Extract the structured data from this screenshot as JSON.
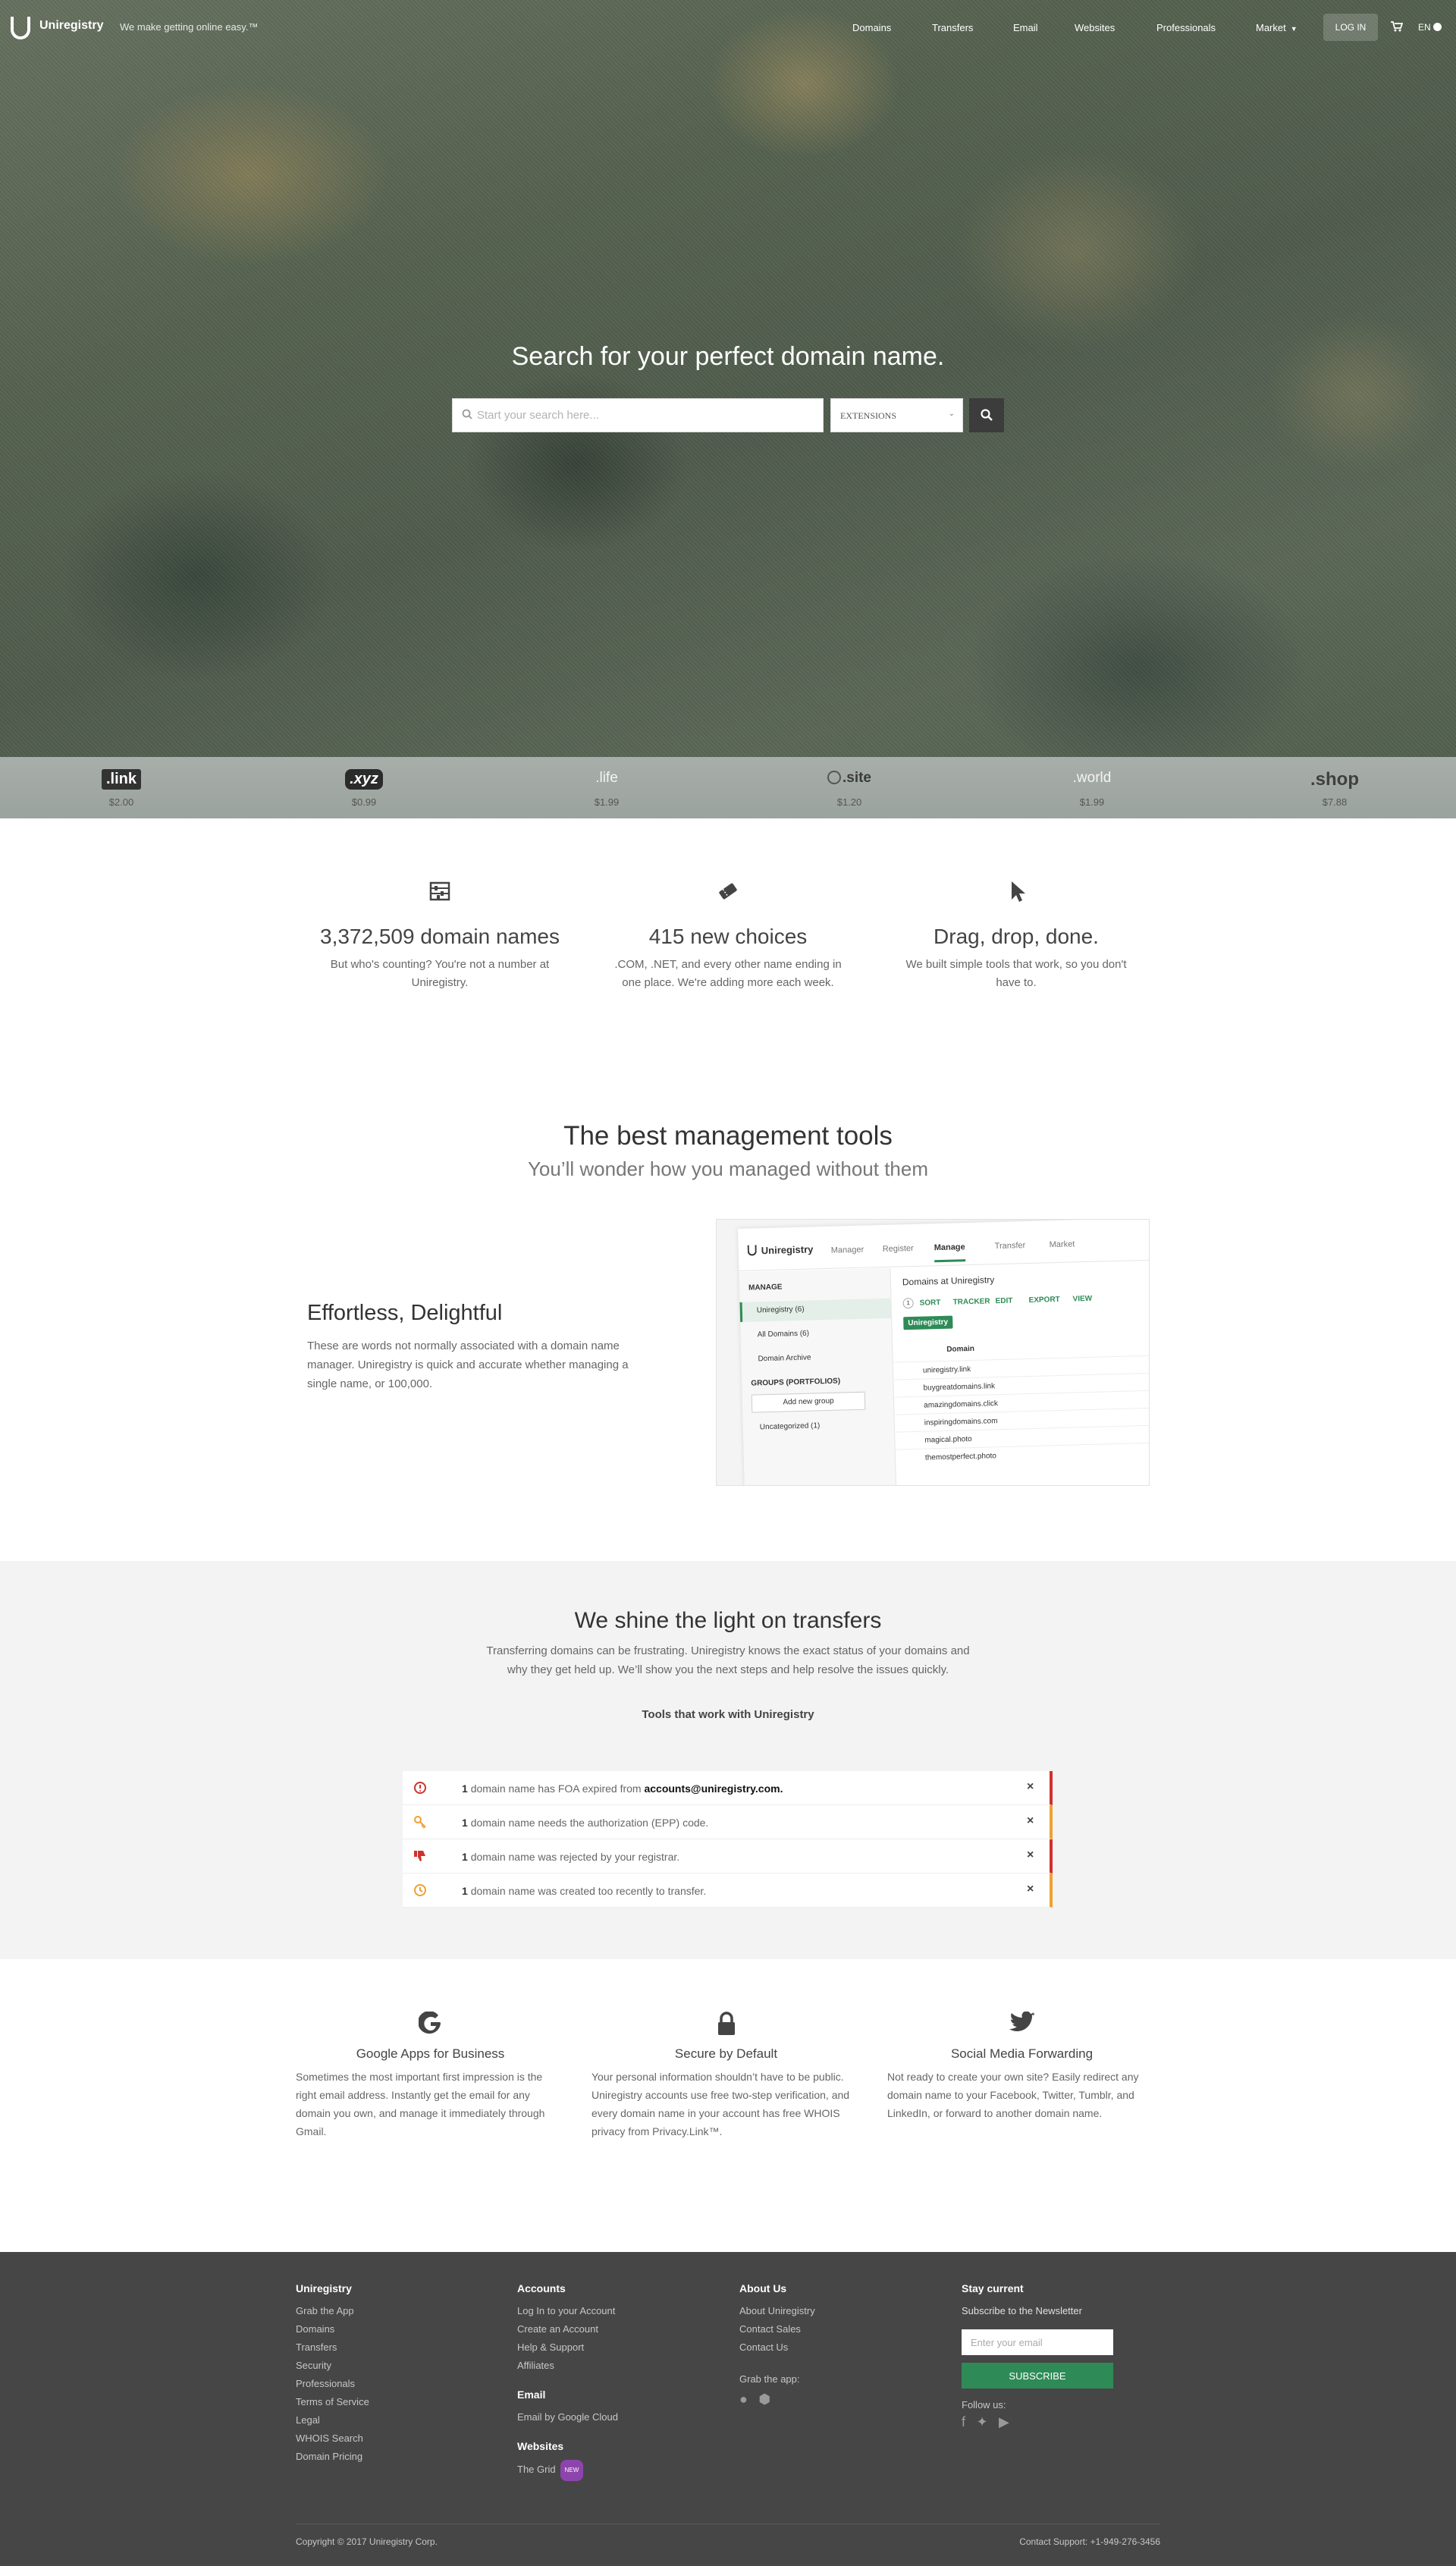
{
  "nav": {
    "brand": "Uniregistry",
    "tagline": "We make getting online easy.™",
    "links": [
      "Domains",
      "Transfers",
      "Email",
      "Websites",
      "Professionals",
      "Market"
    ],
    "login": "LOG IN",
    "lang": "EN"
  },
  "hero": {
    "title": "Search for your perfect domain name.",
    "search_placeholder": "Start your search here...",
    "extensions_label": "EXTENSIONS"
  },
  "tlds": [
    {
      "name": ".link",
      "price": "$2.00"
    },
    {
      "name": ".xyz",
      "price": "$0.99"
    },
    {
      "name": ".life",
      "price": "$1.99"
    },
    {
      "name": ".site",
      "price": "$1.20"
    },
    {
      "name": ".world",
      "price": "$1.99"
    },
    {
      "name": ".shop",
      "price": "$7.88"
    }
  ],
  "stats": [
    {
      "icon": "abacus-icon",
      "title": "3,372,509 domain names",
      "text": "But who's counting? You're not a number at Uniregistry."
    },
    {
      "icon": "ticket-icon",
      "title": "415 new choices",
      "text": ".COM, .NET, and every other name ending in one place. We're adding more each week."
    },
    {
      "icon": "cursor-icon",
      "title": "Drag, drop, done.",
      "text": "We built simple tools that work, so you don't have to."
    }
  ],
  "tools": {
    "title": "The best management tools",
    "subtitle": "You’ll wonder how you managed without them",
    "feature_title": "Effortless, Delightful",
    "feature_text": "These are words not normally associated with a domain name manager.  Uniregistry is quick and accurate whether managing a single name, or 100,000."
  },
  "mock": {
    "brand": "Uniregistry",
    "tabs": [
      "Manager",
      "Register",
      "Manage",
      "Transfer",
      "Market"
    ],
    "side_manage": "MANAGE",
    "side_items": [
      "Uniregistry (6)",
      "All Domains (6)",
      "Domain Archive"
    ],
    "side_groups": "GROUPS (PORTFOLIOS)",
    "side_add": "Add new group",
    "side_uncat": "Uncategorized (1)",
    "main_title": "Domains at Uniregistry",
    "toolbar": [
      "SORT",
      "TRACKER",
      "EDIT",
      "EXPORT",
      "VIEW"
    ],
    "count": "1",
    "tag": "Uniregistry",
    "col_domain": "Domain",
    "rows": [
      "uniregistry.link",
      "buygreatdomains.link",
      "amazingdomains.click",
      "inspiringdomains.com",
      "magical.photo",
      "themostperfect.photo"
    ]
  },
  "transfers": {
    "title": "We shine the light on transfers",
    "text": "Transferring domains can be frustrating.  Uniregistry knows the exact status of your domains and why they get held up.  We’ll show you the next steps and help resolve the issues quickly.",
    "subtitle": "Tools that work with Uniregistry",
    "alerts": [
      {
        "count": "1",
        "text": "domain name has FOA expired from",
        "email": "accounts@uniregistry.com.",
        "color": "#d0312d"
      },
      {
        "count": "1",
        "text": "domain name needs the authorization (EPP) code.",
        "email": "",
        "color": "#f0a030"
      },
      {
        "count": "1",
        "text": "domain name was rejected by your registrar.",
        "email": "",
        "color": "#d0312d"
      },
      {
        "count": "1",
        "text": "domain name was created too recently to transfer.",
        "email": "",
        "color": "#f0a030"
      }
    ],
    "close": "×"
  },
  "features": [
    {
      "icon": "google-icon",
      "title": "Google Apps for Business",
      "text": "Sometimes the most important first impression is the right email address. Instantly get the email for any domain you own, and manage it immediately through Gmail."
    },
    {
      "icon": "lock-icon",
      "title": "Secure by Default",
      "text": "Your personal information shouldn’t have to be public. Uniregistry accounts use free two-step verification, and every domain name in your account has free WHOIS privacy from Privacy.Link™."
    },
    {
      "icon": "twitter-icon",
      "title": "Social Media Forwarding",
      "text": "Not ready to create your own site? Easily redirect any domain name to your Facebook, Twitter, Tumblr, and LinkedIn, or forward to another domain name."
    }
  ],
  "footer": {
    "col1": {
      "head": "Uniregistry",
      "links": [
        "Grab the App",
        "Domains",
        "Transfers",
        "Security",
        "Professionals",
        "Terms of Service",
        "Legal",
        "WHOIS Search",
        "Domain Pricing"
      ]
    },
    "col2": {
      "head": "Accounts",
      "links": [
        "Log In to your Account",
        "Create an Account",
        "Help & Support",
        "Affiliates"
      ],
      "email_head": "Email",
      "email_link": "Email by Google Cloud",
      "web_head": "Websites",
      "web_link": "The Grid",
      "web_badge": "NEW"
    },
    "col3": {
      "head": "About Us",
      "links": [
        "About Uniregistry",
        "Contact Sales",
        "Contact Us"
      ],
      "app_head": "Grab the app:"
    },
    "col4": {
      "head": "Stay current",
      "subhead": "Subscribe to the Newsletter",
      "placeholder": "Enter your email",
      "button": "SUBSCRIBE",
      "follow": "Follow us:"
    },
    "copyright": "Copyright © 2017 Uniregistry Corp.",
    "support": "Contact Support: +1-949-276-3456"
  },
  "colors": {
    "accent": "#2e8b57",
    "footer_bg": "#464646",
    "transfer_bg": "#f3f3f3",
    "new_badge": "#8e44ad"
  }
}
